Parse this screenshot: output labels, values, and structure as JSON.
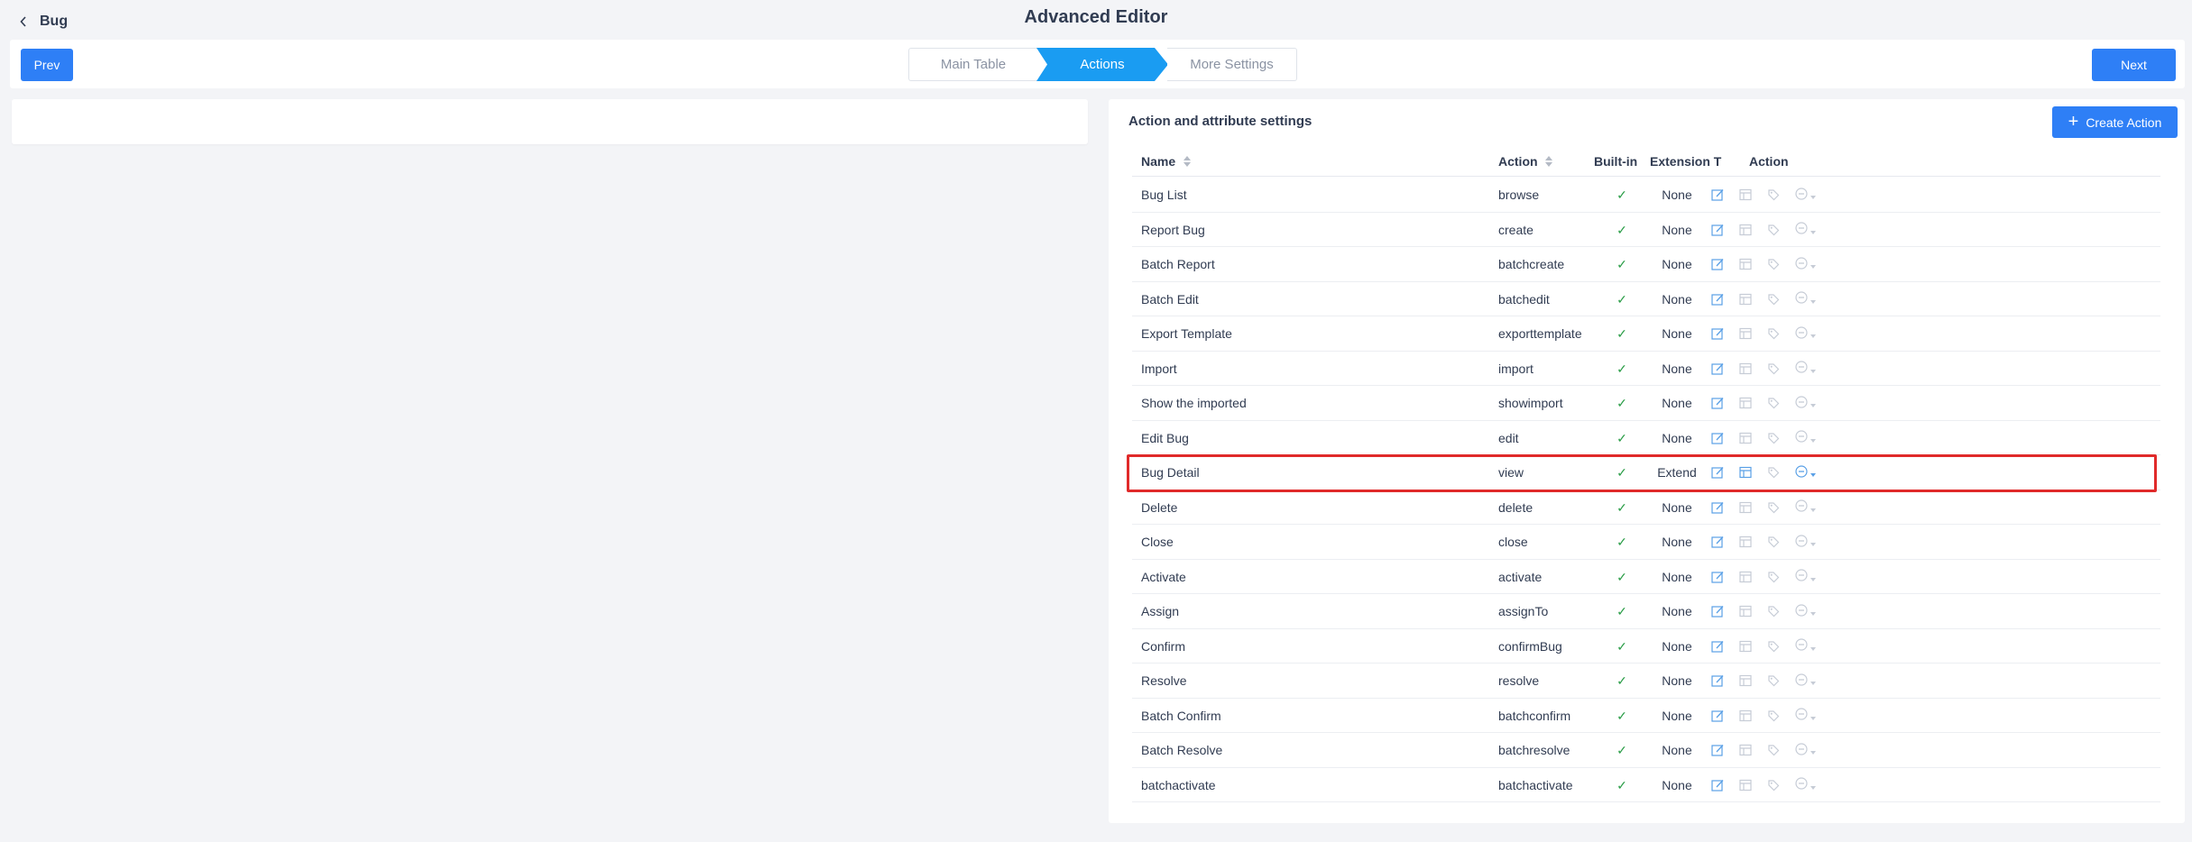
{
  "header": {
    "back_label": "Bug",
    "title": "Advanced Editor"
  },
  "toolbar": {
    "prev_label": "Prev",
    "next_label": "Next",
    "steps": [
      "Main Table",
      "Actions",
      "More Settings"
    ],
    "active_step": "Actions"
  },
  "panel": {
    "title": "Action and attribute settings",
    "create_label": "Create Action"
  },
  "table": {
    "columns": {
      "name": "Name",
      "action": "Action",
      "builtin": "Built-in",
      "extension": "Extension T",
      "ops": "Action"
    },
    "rows": [
      {
        "name": "Bug List",
        "action": "browse",
        "builtin": "✓",
        "extension": "None"
      },
      {
        "name": "Report Bug",
        "action": "create",
        "builtin": "✓",
        "extension": "None"
      },
      {
        "name": "Batch Report",
        "action": "batchcreate",
        "builtin": "✓",
        "extension": "None"
      },
      {
        "name": "Batch Edit",
        "action": "batchedit",
        "builtin": "✓",
        "extension": "None"
      },
      {
        "name": "Export Template",
        "action": "exporttemplate",
        "builtin": "✓",
        "extension": "None"
      },
      {
        "name": "Import",
        "action": "import",
        "builtin": "✓",
        "extension": "None"
      },
      {
        "name": "Show the imported",
        "action": "showimport",
        "builtin": "✓",
        "extension": "None"
      },
      {
        "name": "Edit Bug",
        "action": "edit",
        "builtin": "✓",
        "extension": "None"
      },
      {
        "name": "Bug Detail",
        "action": "view",
        "builtin": "✓",
        "extension": "Extend"
      },
      {
        "name": "Delete",
        "action": "delete",
        "builtin": "✓",
        "extension": "None"
      },
      {
        "name": "Close",
        "action": "close",
        "builtin": "✓",
        "extension": "None"
      },
      {
        "name": "Activate",
        "action": "activate",
        "builtin": "✓",
        "extension": "None"
      },
      {
        "name": "Assign",
        "action": "assignTo",
        "builtin": "✓",
        "extension": "None"
      },
      {
        "name": "Confirm",
        "action": "confirmBug",
        "builtin": "✓",
        "extension": "None"
      },
      {
        "name": "Resolve",
        "action": "resolve",
        "builtin": "✓",
        "extension": "None"
      },
      {
        "name": "Batch Confirm",
        "action": "batchconfirm",
        "builtin": "✓",
        "extension": "None"
      },
      {
        "name": "Batch Resolve",
        "action": "batchresolve",
        "builtin": "✓",
        "extension": "None"
      },
      {
        "name": "batchactivate",
        "action": "batchactivate",
        "builtin": "✓",
        "extension": "None"
      }
    ],
    "highlighted_row": "Bug Detail",
    "row_icons": [
      "edit-icon",
      "layout-icon",
      "tag-icon",
      "more-icon"
    ]
  },
  "colors": {
    "primary": "#2e7ff6",
    "active_step": "#1a9cf2",
    "check": "#2a9d47",
    "highlight_border": "#e02a2a",
    "icon_active": "#5aa0e6",
    "icon_disabled": "#c6ccd6"
  }
}
